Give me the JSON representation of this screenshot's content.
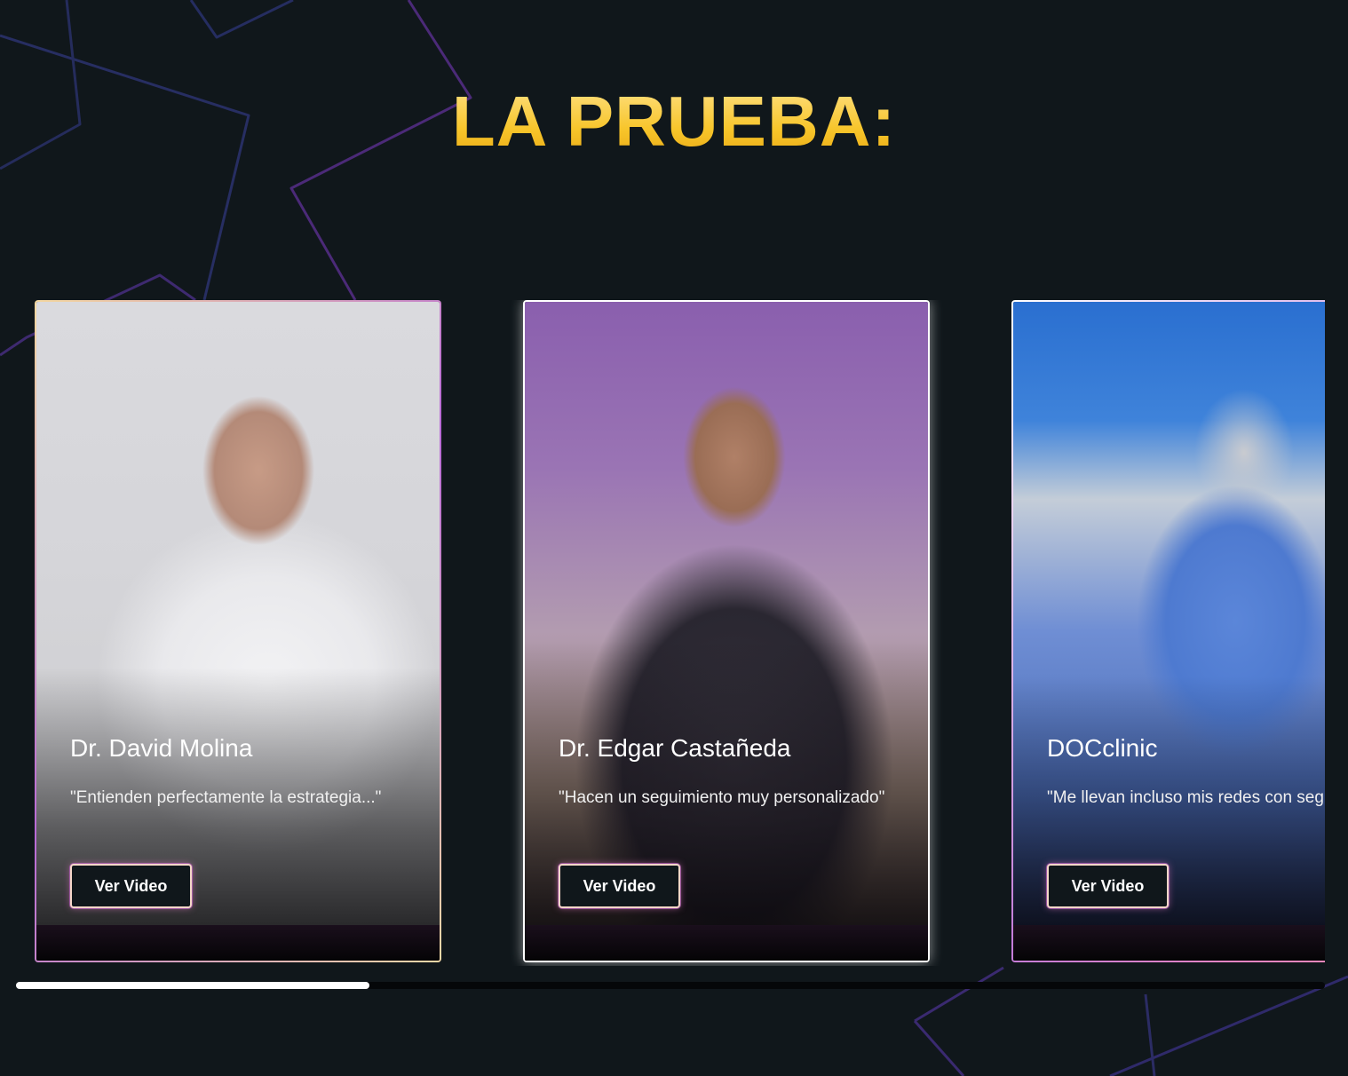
{
  "section": {
    "title": "LA PRUEBA:"
  },
  "testimonials": [
    {
      "name": "Dr. David Molina",
      "quote": "\"Entienden perfectamente la estrategia...\"",
      "button_label": "Ver Video"
    },
    {
      "name": "Dr. Edgar Castañeda",
      "quote": "\"Hacen un seguimiento muy personalizado\"",
      "button_label": "Ver Video"
    },
    {
      "name": "DOCclinic",
      "quote": "\"Me llevan incluso mis redes con seguidores.\"",
      "button_label": "Ver Video"
    }
  ],
  "carousel": {
    "scroll_position": 0.27
  },
  "colors": {
    "background": "#10171b",
    "title_gold": "#f9c930",
    "accent_purple": "#b86ad6",
    "scrollbar_thumb": "#ffffff"
  }
}
